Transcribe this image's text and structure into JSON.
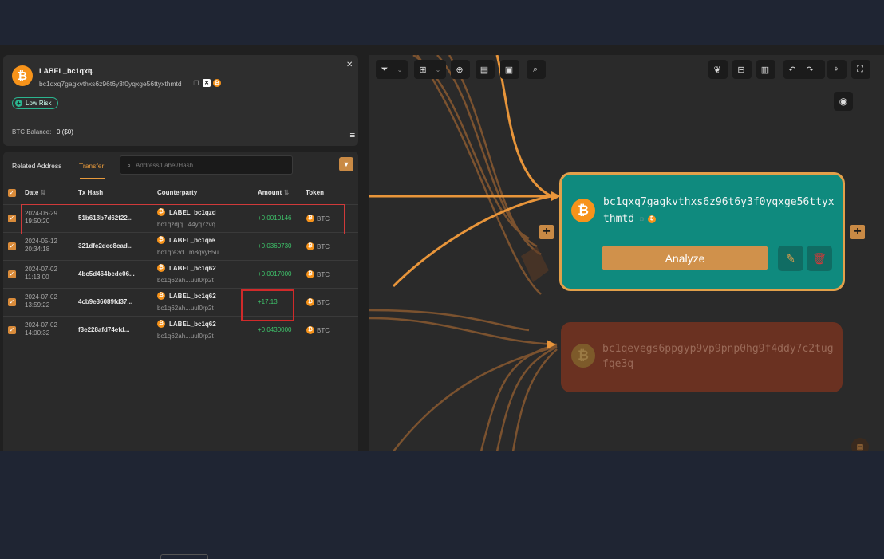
{
  "header": {
    "label": "LABEL_bc1qxq",
    "address": "bc1qxq7gagkvthxs6z96t6y3f0yqxge56ttyxthmtd",
    "risk": "Low Risk",
    "balance_label": "BTC Balance:",
    "balance_value": "0 ($0)"
  },
  "tabs": {
    "related": "Related Address",
    "transfer": "Transfer",
    "active": "Transfer"
  },
  "search": {
    "placeholder": "Address/Label/Hash"
  },
  "table": {
    "columns": [
      "Date",
      "Tx Hash",
      "Counterparty",
      "Amount",
      "Token"
    ],
    "rows": [
      {
        "date": "2024-06-29",
        "time": "19:50:20",
        "hash": "51b618b7d62f22...",
        "cp_label": "LABEL_bc1qzd",
        "cp_addr": "bc1qzdjq...44yq7zvq",
        "amount": "+0.0010146",
        "token": "BTC",
        "checked": true
      },
      {
        "date": "2024-05-12",
        "time": "20:34:18",
        "hash": "321dfc2dec8cad...",
        "cp_label": "LABEL_bc1qre",
        "cp_addr": "bc1qre3d...m8qvy65u",
        "amount": "+0.0360730",
        "token": "BTC",
        "checked": true
      },
      {
        "date": "2024-07-02",
        "time": "11:13:00",
        "hash": "4bc5d464bede06...",
        "cp_label": "LABEL_bc1q62",
        "cp_addr": "bc1q62ah...uul0rp2t",
        "amount": "+0.0017000",
        "token": "BTC",
        "checked": true
      },
      {
        "date": "2024-07-02",
        "time": "13:59:22",
        "hash": "4cb9e36089fd37...",
        "cp_label": "LABEL_bc1q62",
        "cp_addr": "bc1q62ah...uul0rp2t",
        "amount": "+17.13",
        "token": "BTC",
        "checked": true
      },
      {
        "date": "2024-07-02",
        "time": "14:00:32",
        "hash": "f3e228afd74efd...",
        "cp_label": "LABEL_bc1q62",
        "cp_addr": "bc1q62ah...uul0rp2t",
        "amount": "+0.0430000",
        "token": "BTC",
        "checked": true
      }
    ]
  },
  "graph": {
    "main_node": {
      "address": "bc1qxq7gagkvthxs6z96t6y3f0yqxge56ttyxthmtd",
      "analyze_label": "Analyze"
    },
    "secondary_node": {
      "address": "bc1qevegs6ppgyp9vp9pnp0hg9f4ddy7c2tugfqe3q"
    }
  },
  "colors": {
    "accent": "#e89a3c",
    "node_main": "#0f8a7e",
    "node_secondary": "#6a3121",
    "amount_positive": "#3ec46b",
    "highlight": "#d02a2a"
  },
  "icons": [
    "bitcoin-icon",
    "edit-icon",
    "copy-icon",
    "x-icon",
    "close-icon",
    "filter-icon",
    "search-icon",
    "grid-icon",
    "add-circle-icon",
    "notes-icon",
    "report-icon",
    "zoom-icon",
    "bird-icon",
    "layout-icon",
    "panel-icon",
    "undo-icon",
    "redo-icon",
    "target-icon",
    "fullscreen-icon",
    "palette-icon",
    "pencil-icon",
    "trash-icon",
    "plus-icon"
  ]
}
